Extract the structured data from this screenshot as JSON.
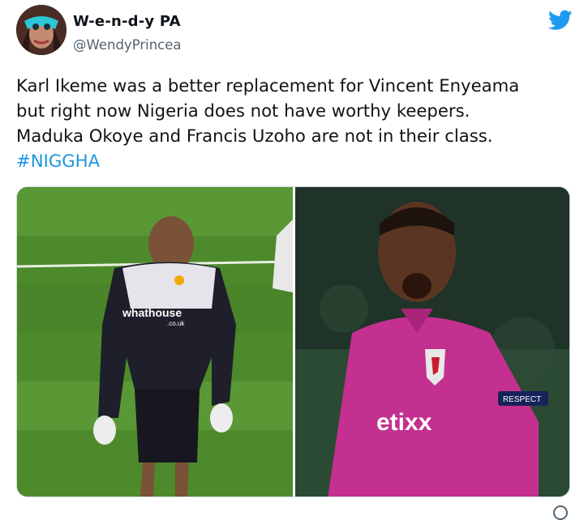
{
  "author": {
    "display_name": "W-e-n-d-y PA",
    "handle": "@WendyPrincea",
    "avatar": "avatar-woman-blue-mask"
  },
  "icons": {
    "twitter_logo": "twitter-bird-icon",
    "info": "info-circle-icon"
  },
  "tweet": {
    "text": "Karl Ikeme was a better replacement for Vincent Enyeama\nbut right now Nigeria does not have worthy keepers.\nMaduka Okoye and Francis Uzoho are not in their class.",
    "hashtag": "#NIGGHA"
  },
  "media": {
    "left_photo": {
      "jersey_text": "whathouse",
      "jersey_subtext": ".co.uk"
    },
    "right_photo": {
      "jersey_text": "etixx",
      "badge_text": "RESPECT"
    }
  },
  "colors": {
    "brand_blue": "#1d9bf0",
    "hashtag": "#1b95e0",
    "text": "#0f1419",
    "secondary": "#536471"
  }
}
